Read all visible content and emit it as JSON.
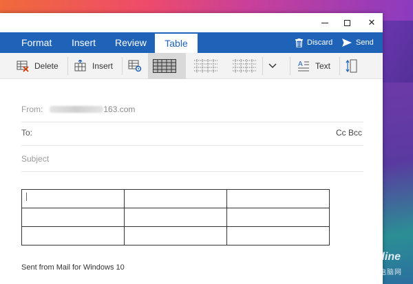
{
  "window": {
    "controls": {
      "minimize": "minimize",
      "maximize": "maximize",
      "close": "✕"
    }
  },
  "menubar": {
    "tabs": [
      {
        "label": "Format"
      },
      {
        "label": "Insert"
      },
      {
        "label": "Review"
      },
      {
        "label": "Table",
        "active": true
      }
    ],
    "actions": {
      "discard": "Discard",
      "send": "Send"
    }
  },
  "ribbon": {
    "delete": "Delete",
    "insert": "Insert",
    "text": "Text"
  },
  "compose": {
    "from_label": "From:",
    "from_value_visible": "163.com",
    "to_label": "To:",
    "cc_bcc": "Cc  Bcc",
    "subject_placeholder": "Subject",
    "table": {
      "rows": 3,
      "cols": 3
    },
    "signature": "Sent from Mail for Windows 10"
  },
  "watermark": {
    "brand": "PConline",
    "sub": "太平洋电脑网"
  },
  "colors": {
    "accent": "#1f63b8",
    "ribbon_bg": "#f3f3f3"
  }
}
